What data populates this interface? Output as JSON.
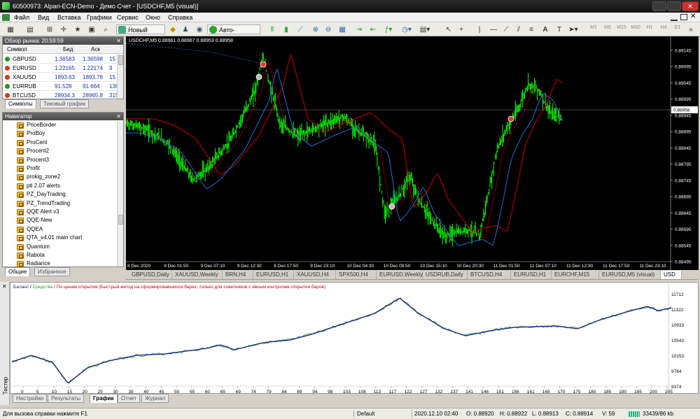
{
  "window": {
    "title": "60500973: Alpari-ECN-Demo - Демо Счет - [USDCHF,M5 (visual)]"
  },
  "menu": [
    "Файл",
    "Вид",
    "Вставка",
    "Графики",
    "Сервис",
    "Окно",
    "Справка"
  ],
  "toolbar": {
    "new_order": "Новый ордер",
    "auto_trading": "Авто-торговля",
    "timeframes": [
      "M1",
      "M5",
      "M15",
      "M30",
      "H1",
      "H4",
      "D1"
    ]
  },
  "market_watch": {
    "title": "Обзор рынка: 20:59:59",
    "columns": [
      "Символ",
      "Бид",
      "Аск",
      ""
    ],
    "rows": [
      {
        "symbol": "GBPUSD",
        "bid": "1.36583",
        "ask": "1.36598",
        "spread": "15",
        "color": "#1a9a1a"
      },
      {
        "symbol": "EURUSD",
        "bid": "1.22165",
        "ask": "1.22174",
        "spread": "9",
        "color": "#d23a1a"
      },
      {
        "symbol": "XAUUSD",
        "bid": "1893.63",
        "ask": "1893.78",
        "spread": "15",
        "color": "#d23a1a"
      },
      {
        "symbol": "EURRUB",
        "bid": "91.528",
        "ask": "91.664",
        "spread": "136",
        "color": "#1a9a1a"
      },
      {
        "symbol": "BTCUSD",
        "bid": "28934.3",
        "ask": "28965.8",
        "spread": "315",
        "color": "#d23a1a"
      }
    ],
    "tabs": [
      "Символы",
      "Тиковый график"
    ]
  },
  "navigator": {
    "title": "Навигатор",
    "items": [
      "PriceBorder",
      "ProBoy",
      "ProCent",
      "Procent2",
      "Procent3",
      "Profit",
      "prokig_zone2",
      "ptl 2.07 alerts",
      "PZ_DayTrading",
      "PZ_TrendTrading",
      "QQE Alert v3",
      "QQE-New",
      "QQEA",
      "QTA_v4.01 main chart",
      "Quantum",
      "Rabota",
      "Radiance"
    ],
    "tabs": [
      "Общие",
      "Избранное"
    ]
  },
  "chart": {
    "header": "USDCHF,M5  0.88961 0.88967 0.88953 0.88958",
    "current_price": "0.88958",
    "price_labels": [
      "0.89145",
      "0.89095",
      "0.89045",
      "0.88995",
      "0.88945",
      "0.88895",
      "0.88845",
      "0.88795",
      "0.88745",
      "0.88695",
      "0.88645",
      "0.88595",
      "0.88545",
      "0.88495"
    ],
    "time_labels": [
      "8 Dec 2020",
      "9 Dec 01:50",
      "9 Dec 07:10",
      "9 Dec 12:30",
      "9 Dec 17:50",
      "9 Dec 23:10",
      "10 Dec 04:30",
      "10 Dec 09:50",
      "10 Dec 15:10",
      "10 Dec 20:30",
      "11 Dec 01:50",
      "11 Dec 07:10",
      "11 Dec 12:30",
      "11 Dec 17:50",
      "11 Dec 23:10"
    ],
    "colors": {
      "price": "#00ff00",
      "ma_slow": "#cc0000",
      "ma_fast": "#1e6fd8",
      "dotted": "#3355aa"
    }
  },
  "chart_tabs": [
    "GBPUSD,Daily",
    "XAUUSD,Weekly",
    "BRN,H4",
    "EURUSD,H1",
    "XAUUSD,H4",
    "SPX500,H4",
    "EURUSD,Weekly",
    "USDRUB,Daily",
    "BTCUSD,H4",
    "EURUSD,H1",
    "EURCHF,M15",
    "EURUSD,M5 (visual)",
    "USD"
  ],
  "tester": {
    "legend_balance": "Баланс",
    "legend_sep": " / ",
    "legend_equity": "Средства",
    "legend_note": " / По ценам открытия (Быстрый метод на сформировавшихся барах, только для советников с явным контролем открытия баров)",
    "y_labels": [
      "11712",
      "11322",
      "10933",
      "10543",
      "10153",
      "9764",
      "9374"
    ],
    "x_labels": [
      "0",
      "5",
      "10",
      "15",
      "20",
      "25",
      "30",
      "35",
      "40",
      "45",
      "50",
      "55",
      "60",
      "65",
      "69",
      "74",
      "79",
      "84",
      "89",
      "94",
      "98",
      "103",
      "108",
      "113",
      "117",
      "122",
      "127",
      "132",
      "137",
      "141",
      "146",
      "151",
      "156",
      "161",
      "165",
      "170",
      "175",
      "180",
      "185",
      "190",
      "195",
      "200",
      "205"
    ],
    "side_label": "Тестер",
    "tabs": [
      "Настройки",
      "Результаты",
      "График",
      "Отчет",
      "Журнал"
    ],
    "active_tab": "График"
  },
  "status": {
    "help": "Для вызова справки нажмите F1",
    "profile": "Default",
    "datetime": "2020.12.10 02:40",
    "open": "O: 0.88920",
    "high": "H: 0.88922",
    "low": "L: 0.88913",
    "close": "C: 0.88914",
    "volume": "V: 59",
    "traffic": "33439/86 kb"
  }
}
